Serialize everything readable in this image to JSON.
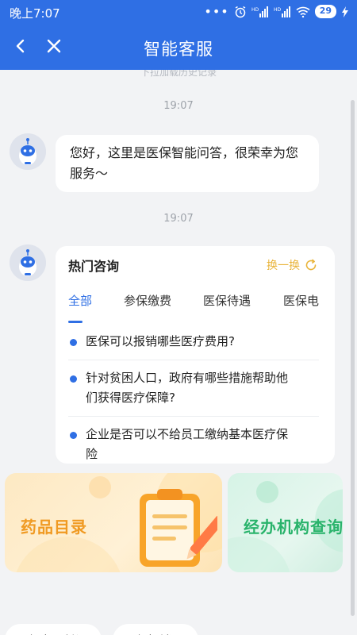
{
  "status_bar": {
    "time": "晚上7:07",
    "battery": "29"
  },
  "nav": {
    "title": "智能客服"
  },
  "chat": {
    "history_hint": "下拉加载历史记录",
    "messages": [
      {
        "time": "19:07",
        "text_line1": "您好，这里是医保智能问答，很荣幸为您",
        "text_line2": "服务～"
      },
      {
        "time": "19:07"
      }
    ]
  },
  "hot_card": {
    "title": "热门咨询",
    "refresh_label": "换一换",
    "tabs": [
      "全部",
      "参保缴费",
      "医保待遇",
      "医保电"
    ],
    "questions": [
      {
        "line1": "医保可以报销哪些医疗费用?",
        "line2": ""
      },
      {
        "line1": "针对贫困人口，政府有哪些措施帮助他",
        "line2": "们获得医疗保障?"
      },
      {
        "line1": "企业是否可以不给员工缴纳基本医疗保",
        "line2": "险"
      }
    ]
  },
  "services": [
    {
      "label": "药品目录",
      "icon": "clipboard-pencil-icon"
    },
    {
      "label": "经办机构查询",
      "icon": "building-icon"
    }
  ],
  "quick_links": [
    "医保电子凭证",
    "医保报销"
  ],
  "colors": {
    "primary": "#2f6fe4",
    "accent": "#e9b43a",
    "drug": "#f09a22",
    "org": "#29b36b"
  }
}
